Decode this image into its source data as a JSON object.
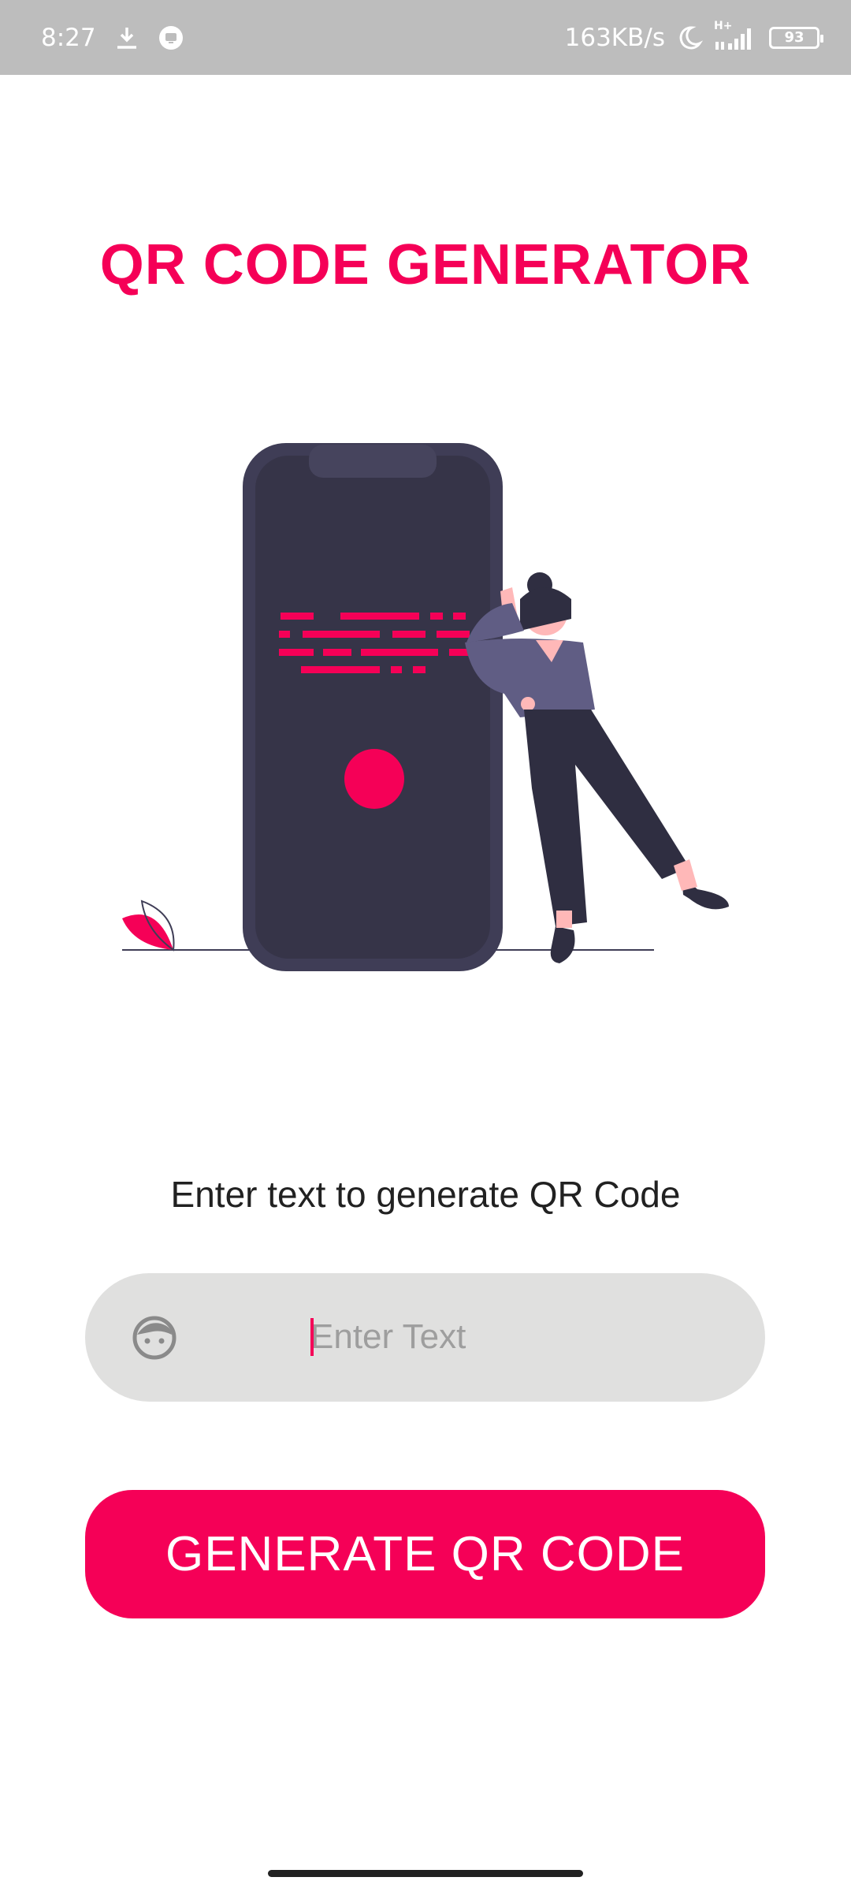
{
  "status_bar": {
    "time": "8:27",
    "icons_left": [
      "download-icon",
      "screen-record-icon"
    ],
    "network_speed": "163KB/s",
    "icons_right": [
      "moon-icon",
      "signal-icon"
    ],
    "network_type": "H+",
    "battery": "93"
  },
  "header": {
    "title": "QR CODE GENERATOR"
  },
  "form": {
    "prompt": "Enter text to generate QR Code",
    "input_placeholder": "Enter Text",
    "input_value": "",
    "input_icon": "face-icon"
  },
  "actions": {
    "generate_label": "GENERATE QR CODE"
  },
  "colors": {
    "accent": "#f50057",
    "phone_body": "#3f3d56",
    "input_bg": "#e0e0df",
    "status_bar_bg": "#bdbdbd"
  }
}
